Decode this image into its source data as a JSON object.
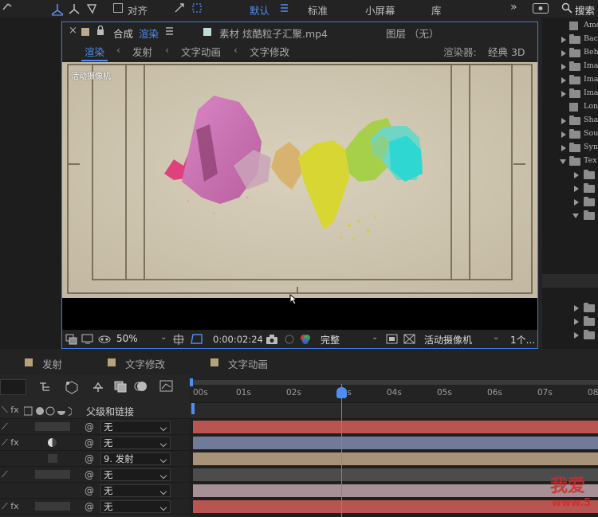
{
  "toolbar": {
    "align_label": "对齐",
    "workspaces": [
      "默认",
      "标准",
      "小屏幕",
      "库"
    ],
    "search_label": "搜索"
  },
  "composition": {
    "tab_prefix": "合成",
    "tab_name": "渲染",
    "footage_tab": "素材 炫酷粒子汇聚.mp4",
    "layer_tab": "图层 （无）",
    "breadcrumbs": [
      "渲染",
      "发射",
      "文字动画",
      "文字修改"
    ],
    "renderer_label": "渲染器:",
    "renderer_value": "经典 3D",
    "camera_overlay": "活动摄像机",
    "zoom": "50%",
    "timecode": "0:00:02:24",
    "resolution": "完整",
    "view": "活动摄像机",
    "views": "1个..."
  },
  "project": {
    "items": [
      {
        "label": "Amo",
        "kind": "file"
      },
      {
        "label": "Bac",
        "kind": "folder"
      },
      {
        "label": "Beh",
        "kind": "folder"
      },
      {
        "label": "Ima",
        "kind": "folder"
      },
      {
        "label": "Ima",
        "kind": "folder"
      },
      {
        "label": "Ima",
        "kind": "folder"
      },
      {
        "label": "Lon",
        "kind": "file"
      },
      {
        "label": "Sha",
        "kind": "folder"
      },
      {
        "label": "Sou",
        "kind": "folder"
      },
      {
        "label": "Syn",
        "kind": "folder"
      },
      {
        "label": "Tex",
        "kind": "folder-open"
      }
    ]
  },
  "timeline": {
    "tabs": [
      {
        "label": "发射",
        "color": "#b8a27a"
      },
      {
        "label": "文字修改",
        "color": "#b8a27a"
      },
      {
        "label": "文字动画",
        "color": "#b8a27a"
      }
    ],
    "parent_header": "父级和链接",
    "ruler": [
      "00s",
      "01s",
      "02s",
      "03s",
      "04s",
      "05s",
      "06s",
      "07s",
      "08"
    ],
    "current_time_seconds": 2.96,
    "layers": [
      {
        "parent": "无",
        "bar_color": "#b95550"
      },
      {
        "parent": "无",
        "bar_color": "#717a98"
      },
      {
        "parent": "9. 发射",
        "bar_color": "#a8937a"
      },
      {
        "parent": "无",
        "bar_color": "#4c4c4c"
      },
      {
        "parent": "无",
        "bar_color": "#a69196"
      },
      {
        "parent": "无",
        "bar_color": "#b95550"
      }
    ]
  },
  "watermark": {
    "text": "我爱",
    "url": "www.5"
  },
  "colors": {
    "accent": "#4f8df5",
    "panel_border": "#3d7be0",
    "canvas": "#cfc6b1"
  }
}
